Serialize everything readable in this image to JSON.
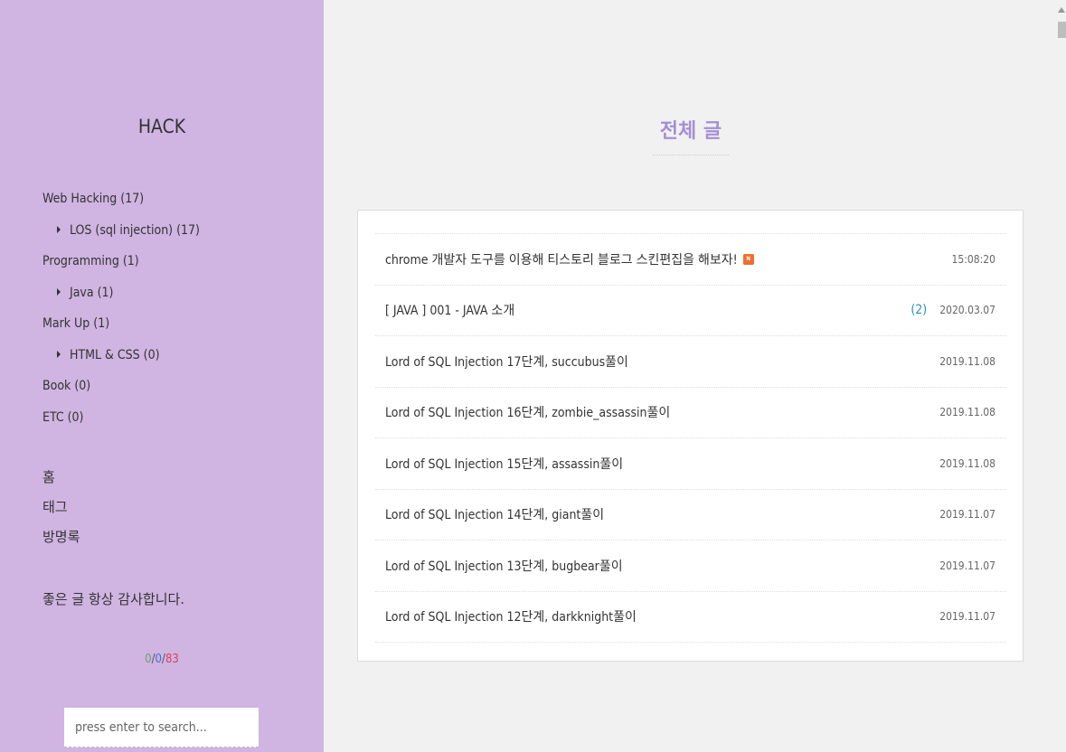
{
  "sidebar": {
    "blog_title": "HACK",
    "categories": [
      {
        "label": "Web Hacking (17)",
        "sub": false
      },
      {
        "label": "LOS (sql injection) (17)",
        "sub": true
      },
      {
        "label": "Programming (1)",
        "sub": false
      },
      {
        "label": "Java (1)",
        "sub": true
      },
      {
        "label": "Mark Up (1)",
        "sub": false
      },
      {
        "label": "HTML & CSS (0)",
        "sub": true
      },
      {
        "label": "Book (0)",
        "sub": false
      },
      {
        "label": "ETC (0)",
        "sub": false
      }
    ],
    "nav": [
      "홈",
      "태그",
      "방명록"
    ],
    "greeting": "좋은 글 항상 감사합니다.",
    "counter": {
      "total": "0",
      "today": "0",
      "yesterday": "83",
      "sep": "/"
    },
    "search_placeholder": "press enter to search..."
  },
  "main": {
    "heading": "전체 글",
    "posts": [
      {
        "title": "chrome 개발자 도구를 이용해 티스토리 블로그 스킨편집을 해보자!",
        "new": true,
        "new_label": "N",
        "comments": "",
        "date": "15:08:20"
      },
      {
        "title": "[ JAVA ] 001 - JAVA 소개",
        "new": false,
        "comments": "(2)",
        "date": "2020.03.07"
      },
      {
        "title": "Lord of SQL Injection 17단계, succubus풀이",
        "new": false,
        "comments": "",
        "date": "2019.11.08"
      },
      {
        "title": "Lord of SQL Injection 16단계, zombie_assassin풀이",
        "new": false,
        "comments": "",
        "date": "2019.11.08"
      },
      {
        "title": "Lord of SQL Injection 15단계, assassin풀이",
        "new": false,
        "comments": "",
        "date": "2019.11.08"
      },
      {
        "title": "Lord of SQL Injection 14단계, giant풀이",
        "new": false,
        "comments": "",
        "date": "2019.11.07"
      },
      {
        "title": "Lord of SQL Injection 13단계, bugbear풀이",
        "new": false,
        "comments": "",
        "date": "2019.11.07"
      },
      {
        "title": "Lord of SQL Injection 12단계, darkknight풀이",
        "new": false,
        "comments": "",
        "date": "2019.11.07"
      }
    ]
  },
  "colors": {
    "sidebar_bg": "#d0b4e2",
    "heading": "#a58fd6",
    "new_badge": "#ef6f2e",
    "comments": "#2b8fbd"
  }
}
